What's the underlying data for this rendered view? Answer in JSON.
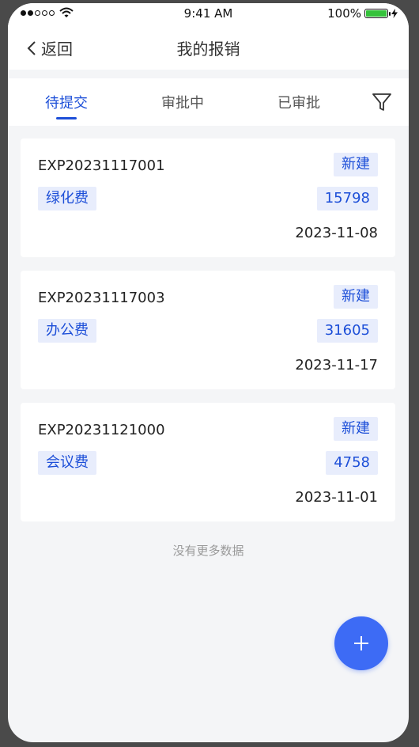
{
  "status_bar": {
    "time": "9:41 AM",
    "battery_percent": "100%",
    "signal_bars_filled": 2,
    "signal_bars_total": 5
  },
  "nav": {
    "back_label": "返回",
    "title": "我的报销"
  },
  "tabs": [
    {
      "label": "待提交",
      "active": true
    },
    {
      "label": "审批中",
      "active": false
    },
    {
      "label": "已审批",
      "active": false
    }
  ],
  "cards": [
    {
      "no": "EXP20231117001",
      "status": "新建",
      "category": "绿化费",
      "amount": "15798",
      "date": "2023-11-08"
    },
    {
      "no": "EXP20231117003",
      "status": "新建",
      "category": "办公费",
      "amount": "31605",
      "date": "2023-11-17"
    },
    {
      "no": "EXP20231121000",
      "status": "新建",
      "category": "会议费",
      "amount": "4758",
      "date": "2023-11-01"
    }
  ],
  "footer": {
    "no_more_text": "没有更多数据"
  },
  "icons": {
    "back": "chevron-left-icon",
    "filter": "filter-icon",
    "add": "plus-icon",
    "wifi": "wifi-icon",
    "battery": "battery-icon",
    "charging": "charging-bolt-icon"
  },
  "colors": {
    "accent": "#1d4fd8",
    "tag_bg": "#e8edfc",
    "fab": "#3d6bf5",
    "battery": "#35c23b"
  }
}
